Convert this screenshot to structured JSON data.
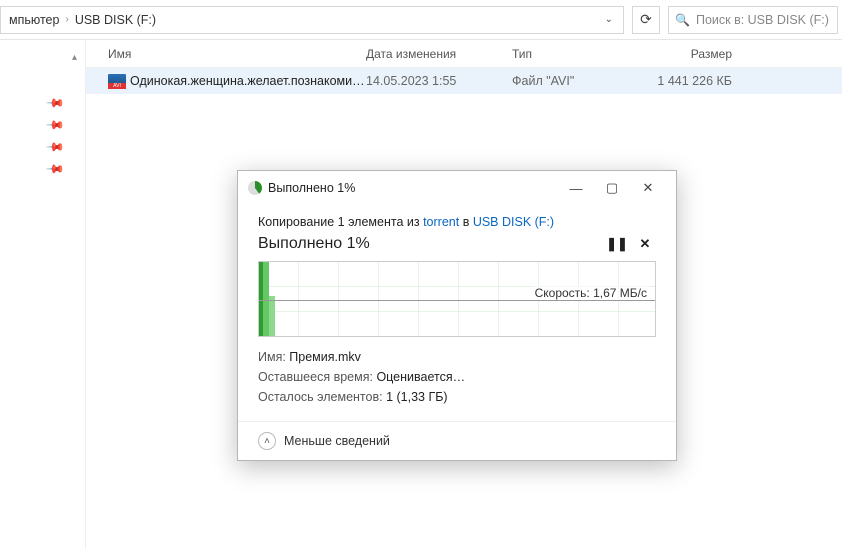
{
  "breadcrumb": {
    "seg1": "мпьютер",
    "seg2": "USB DISK (F:)"
  },
  "search": {
    "placeholder": "Поиск в: USB DISK (F:)"
  },
  "columns": {
    "name": "Имя",
    "date": "Дата изменения",
    "type": "Тип",
    "size": "Размер"
  },
  "files": [
    {
      "name": "Одинокая.женщина.желает.познакоми…",
      "date": "14.05.2023 1:55",
      "type": "Файл \"AVI\"",
      "size": "1 441 226 КБ"
    }
  ],
  "dialog": {
    "title": "Выполнено 1%",
    "copy_prefix": "Копирование 1 элемента из ",
    "src": "torrent",
    "mid": " в ",
    "dst": "USB DISK (F:)",
    "progress_label": "Выполнено 1%",
    "speed_label": "Скорость: ",
    "speed_value": "1,67 МБ/с",
    "name_label": "Имя: ",
    "name_value": "Премия.mkv",
    "remain_label": "Оставшееся время: ",
    "remain_value": "Оценивается…",
    "items_label": "Осталось элементов: ",
    "items_value": "1 (1,33 ГБ)",
    "toggle": "Меньше сведений"
  }
}
